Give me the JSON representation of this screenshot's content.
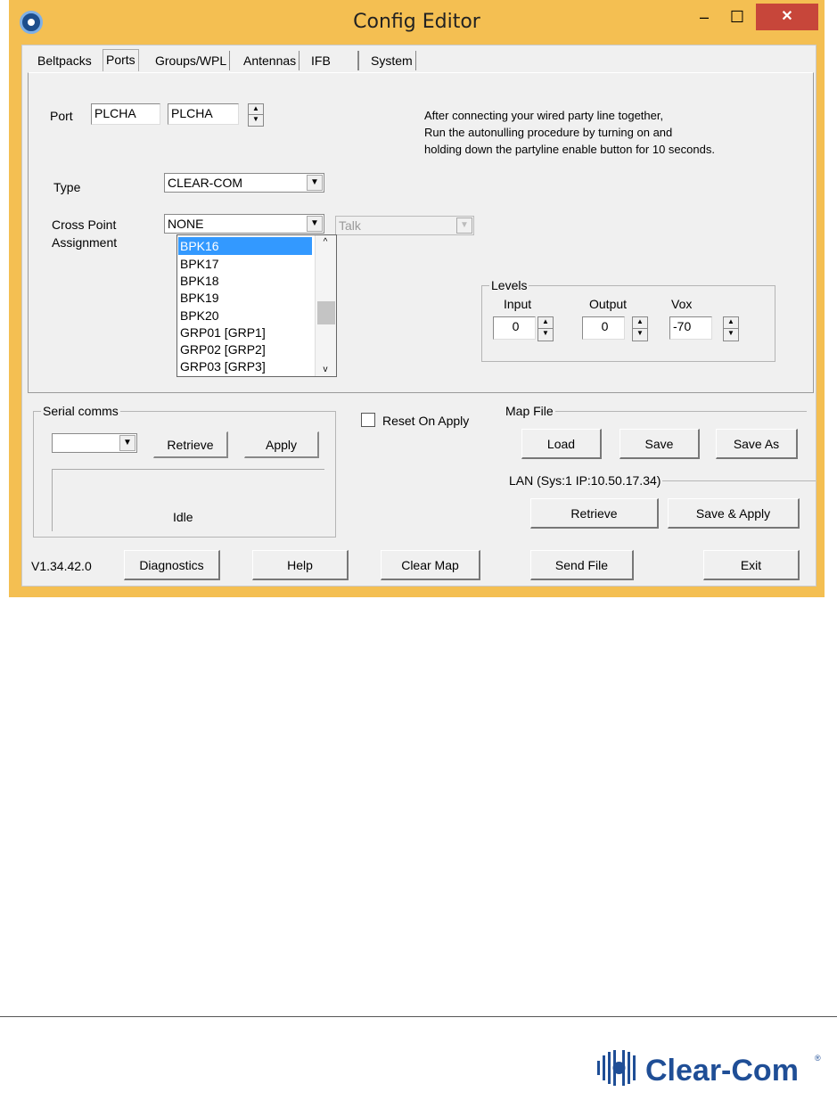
{
  "window": {
    "title": "Config Editor",
    "controls": {
      "minimize": "–",
      "maximize": "☐",
      "close": "✕"
    }
  },
  "tabs": [
    "Beltpacks",
    "Ports",
    "Groups/WPL",
    "Antennas",
    "IFB",
    "System"
  ],
  "active_tab": "Ports",
  "port": {
    "label": "Port",
    "field1": "PLCHA",
    "field2": "PLCHA"
  },
  "instructions": [
    "After connecting your wired party line together,",
    "Run the autonulling procedure by turning on and",
    "holding down the partyline enable button for 10 seconds."
  ],
  "type": {
    "label": "Type",
    "value": "CLEAR-COM"
  },
  "cross_point": {
    "label_line1": "Cross Point",
    "label_line2": "Assignment",
    "value": "NONE",
    "mode": "Talk",
    "options": [
      "BPK16",
      "BPK17",
      "BPK18",
      "BPK19",
      "BPK20",
      "GRP01 [GRP1]",
      "GRP02 [GRP2]",
      "GRP03 [GRP3]"
    ],
    "selected": "BPK16"
  },
  "levels": {
    "title": "Levels",
    "input_label": "Input",
    "input_value": "0",
    "output_label": "Output",
    "output_value": "0",
    "vox_label": "Vox",
    "vox_value": "-70"
  },
  "serial": {
    "title": "Serial comms",
    "port_value": "",
    "retrieve": "Retrieve",
    "apply": "Apply",
    "status": "Idle"
  },
  "reset_on_apply": {
    "label": "Reset On Apply",
    "checked": false
  },
  "map_file": {
    "title": "Map File",
    "load": "Load",
    "save": "Save",
    "save_as": "Save As"
  },
  "lan": {
    "title": "LAN  (Sys:1 IP:10.50.17.34)",
    "retrieve": "Retrieve",
    "save_apply": "Save & Apply"
  },
  "bottom": {
    "version": "V1.34.42.0",
    "diagnostics": "Diagnostics",
    "help": "Help",
    "clear_map": "Clear Map",
    "send_file": "Send File",
    "exit": "Exit"
  },
  "logo_text": "Clear-Com",
  "colors": {
    "title_bar": "#f4bf52",
    "close_button": "#c7463a",
    "selection": "#3399ff",
    "logo_blue": "#1f4e96"
  }
}
